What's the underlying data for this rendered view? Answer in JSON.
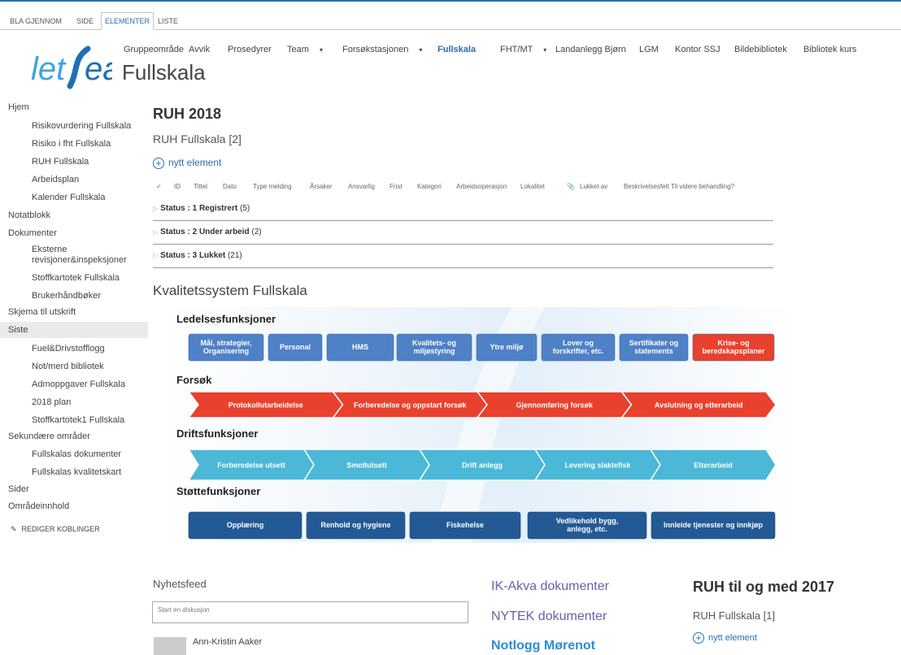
{
  "ribbon": {
    "tabs": [
      "BLA GJENNOM",
      "SIDE",
      "ELEMENTER",
      "LISTE"
    ]
  },
  "logo": {
    "text_a": "let",
    "text_b": "sea"
  },
  "topnav": {
    "items": [
      "Gruppeområde",
      "Avvik",
      "Prosedyrer",
      "Team",
      "Forsøkstasjonen",
      "Fullskala",
      "FHT/MT",
      "Landanlegg Bjørn",
      "LGM",
      "Kontor SSJ",
      "Bildebibliotek",
      "Bibliotek kurs"
    ],
    "selected": "Fullskala"
  },
  "site_title": "Fullskala",
  "leftnav": {
    "items": [
      "Hjem",
      "Risikovurdering Fullskala",
      "Risiko i fht Fullskala",
      "RUH Fullskala",
      "Arbeidsplan",
      "Kalender Fullskala",
      "Notatblokk",
      "Dokumenter",
      "Eksterne",
      "revisjoner&inspeksjoner",
      "Stoffkartotek Fullskala",
      "Brukerhåndbøker",
      "Skjema til utskrift",
      "Siste",
      "Fuel&Drivstofflogg",
      "Not/merd bibliotek",
      "Admoppgaver Fullskala",
      "2018 plan",
      "Stoffkartotek1 Fullskala",
      "Sekundære områder",
      "Fullskalas dokumenter",
      "Fullskalas kvalitetskart",
      "Sider",
      "Områdeinnhold"
    ],
    "edit_links": "REDIGER KOBLINGER"
  },
  "main": {
    "heading": "RUH 2018",
    "list_title": "RUH Fullskala [2]",
    "new_item": "nytt element",
    "columns": [
      "ID",
      "Tittel",
      "Dato",
      "Type melding",
      "Årsaker",
      "Ansvarlig",
      "Frist",
      "Kategori",
      "Arbeidsoperasjon",
      "Lokalitet",
      "Lukket av",
      "Beskrivelsesfelt",
      "Til videre behandling?"
    ],
    "groups": [
      {
        "label": "Status : 1 Registrert",
        "count": "(5)"
      },
      {
        "label": "Status : 2 Under arbeid",
        "count": "(2)"
      },
      {
        "label": "Status : 3 Lukket",
        "count": "(21)"
      }
    ],
    "quality_heading": "Kvalitetssystem Fullskala"
  },
  "diagram": {
    "section1": "Ledelsesfunksjoner",
    "boxes1": [
      "Mål, strategier,|Organisering",
      "Personal",
      "HMS",
      "Kvalitets- og|miljøstyring",
      "Ytre miljø",
      "Lover og|forskrifter, etc.",
      "Sertifikater og|statements",
      "Krise- og|beredskapsplaner"
    ],
    "section2": "Forsøk",
    "arrows2": [
      "Protokollutarbeidelse",
      "Forberedelse og oppstart forsøk",
      "Gjennomføring forsøk",
      "Avslutning og etterarbeid"
    ],
    "section3": "Driftsfunksjoner",
    "arrows3": [
      "Forberedelse utsett",
      "Smoltutsett",
      "Drift anlegg",
      "Levering slaktefisk",
      "Etterarbeid"
    ],
    "section4": "Støttefunksjoner",
    "boxes4": [
      "Opplæring",
      "Renhold og hygiene",
      "Fiskehelse",
      "Vedlikehold bygg,|anlegg, etc.",
      "Innleide tjenester og innkjøp"
    ],
    "colors": {
      "blue": "#4f81c7",
      "red": "#e8412e",
      "cyan": "#4bb8d8",
      "navy": "#235a96"
    }
  },
  "feed": {
    "label": "Nyhetsfeed",
    "placeholder": "Start en diskusjon",
    "author": "Ann-Kristin Aaker"
  },
  "links": {
    "ik_akva": "IK-Akva dokumenter",
    "nytek": "NYTEK dokumenter",
    "notlogg": "Notlogg Mørenot"
  },
  "ruh_old": {
    "heading": "RUH til og med 2017",
    "list_title": "RUH Fullskala [1]",
    "new_item": "nytt element"
  }
}
